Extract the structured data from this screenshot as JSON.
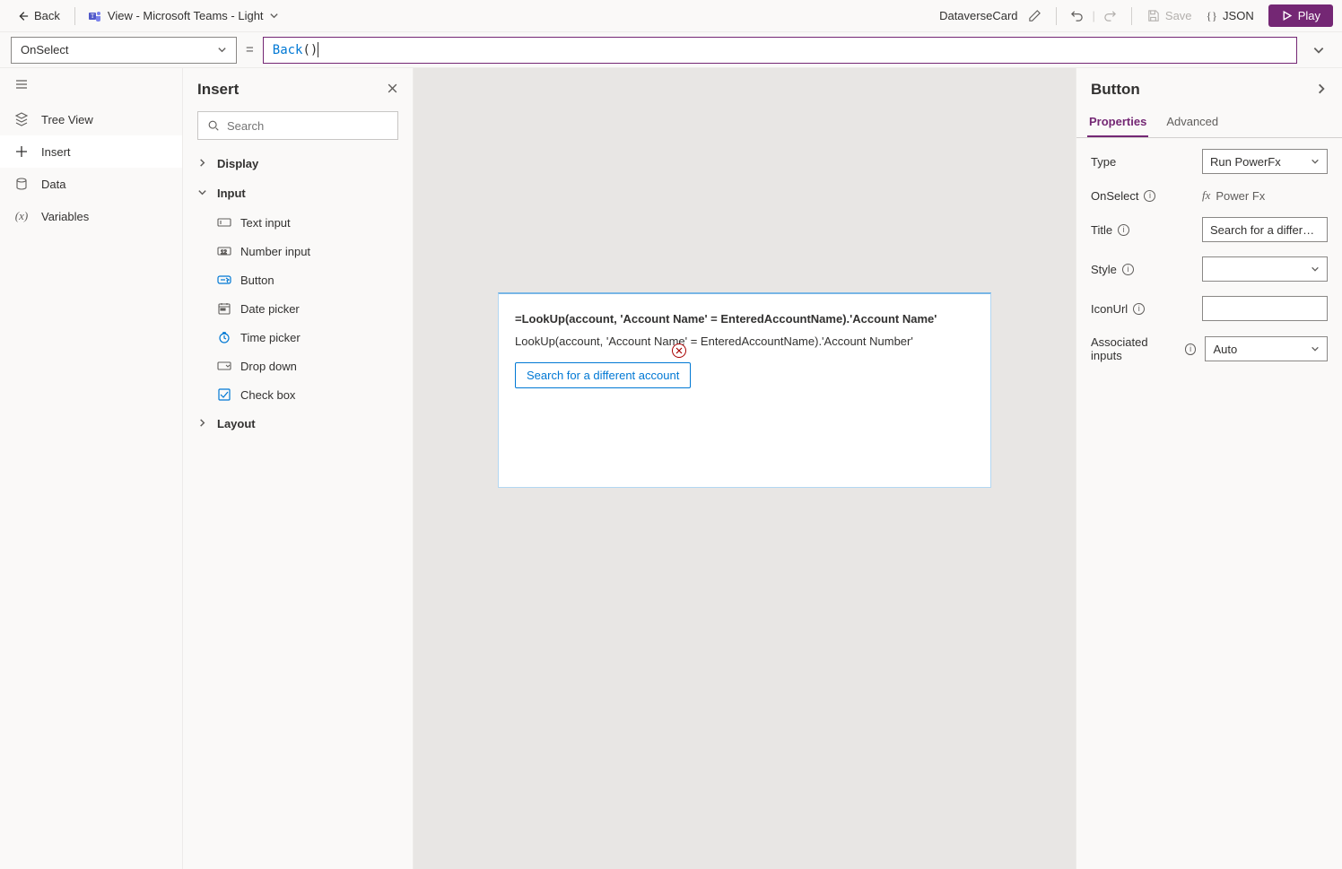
{
  "topbar": {
    "back": "Back",
    "view_label": "View - Microsoft Teams - Light",
    "card_name": "DataverseCard",
    "save": "Save",
    "json": "JSON",
    "play": "Play"
  },
  "formula": {
    "property": "OnSelect",
    "expression_fn": "Back",
    "expression_rest": "()"
  },
  "leftRail": {
    "treeview": "Tree View",
    "insert": "Insert",
    "data": "Data",
    "variables": "Variables"
  },
  "insertPanel": {
    "title": "Insert",
    "searchPlaceholder": "Search",
    "categories": {
      "display": "Display",
      "input": "Input",
      "layout": "Layout"
    },
    "inputItems": {
      "textInput": "Text input",
      "numberInput": "Number input",
      "button": "Button",
      "datePicker": "Date picker",
      "timePicker": "Time picker",
      "dropdown": "Drop down",
      "checkbox": "Check box"
    }
  },
  "canvasCard": {
    "line1": "=LookUp(account, 'Account Name' = EnteredAccountName).'Account Name'",
    "line2": "LookUp(account, 'Account Name' = EnteredAccountName).'Account Number'",
    "buttonLabel": "Search for a different account"
  },
  "rightPanel": {
    "heading": "Button",
    "tabs": {
      "properties": "Properties",
      "advanced": "Advanced"
    },
    "props": {
      "type": {
        "label": "Type",
        "value": "Run PowerFx"
      },
      "onSelect": {
        "label": "OnSelect",
        "value": "Power Fx"
      },
      "title": {
        "label": "Title",
        "value": "Search for a different account"
      },
      "style": {
        "label": "Style",
        "value": ""
      },
      "iconUrl": {
        "label": "IconUrl",
        "value": ""
      },
      "assocInputs": {
        "label": "Associated inputs",
        "value": "Auto"
      }
    }
  }
}
